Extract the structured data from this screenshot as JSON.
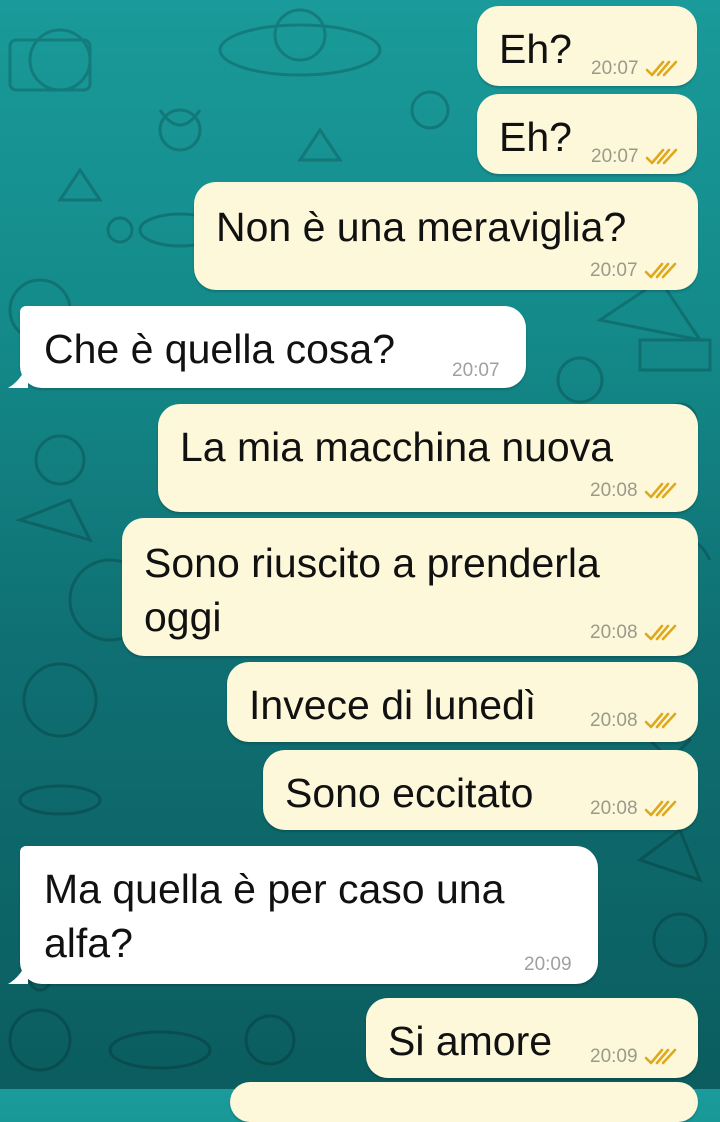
{
  "colors": {
    "outgoing_bubble": "#fdf8da",
    "incoming_bubble": "#ffffff",
    "read_ticks": "#e0a81c",
    "wallpaper_top": "#1a9a9a",
    "wallpaper_bottom": "#0b5d5f"
  },
  "messages": [
    {
      "direction": "outgoing",
      "text": "Eh?",
      "time": "20:07",
      "status": "read-ticks-icon"
    },
    {
      "direction": "outgoing",
      "text": "Eh?",
      "time": "20:07",
      "status": "read-ticks-icon"
    },
    {
      "direction": "outgoing",
      "text": "Non è una meraviglia?",
      "time": "20:07",
      "status": "read-ticks-icon"
    },
    {
      "direction": "incoming",
      "text": "Che è quella cosa?",
      "time": "20:07"
    },
    {
      "direction": "outgoing",
      "text": "La mia macchina nuova",
      "time": "20:08",
      "status": "read-ticks-icon"
    },
    {
      "direction": "outgoing",
      "text_line1": "Sono riuscito a prenderla",
      "text_line2": "oggi",
      "time": "20:08",
      "status": "read-ticks-icon"
    },
    {
      "direction": "outgoing",
      "text": "Invece di lunedì",
      "time": "20:08",
      "status": "read-ticks-icon"
    },
    {
      "direction": "outgoing",
      "text": "Sono eccitato",
      "time": "20:08",
      "status": "read-ticks-icon"
    },
    {
      "direction": "incoming",
      "text_line1": "Ma quella è per caso una",
      "text_line2": "alfa?",
      "time": "20:09"
    },
    {
      "direction": "outgoing",
      "text": "Si amore",
      "time": "20:09",
      "status": "read-ticks-icon"
    }
  ]
}
